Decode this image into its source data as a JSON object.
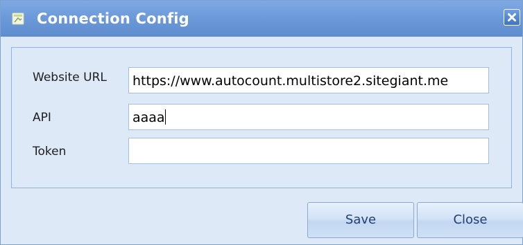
{
  "window": {
    "title": "Connection Config"
  },
  "form": {
    "website_url": {
      "label": "Website URL",
      "value": "https://www.autocount.multistore2.sitegiant.me"
    },
    "api": {
      "label": "API",
      "value": "aaaa"
    },
    "token": {
      "label": "Token",
      "value": ""
    }
  },
  "buttons": {
    "save_label": "Save",
    "close_label": "Close"
  },
  "colors": {
    "titlebar": "#6b98d8",
    "body_background": "#dde9f7",
    "group_border": "#8db2e3",
    "button_text": "#1e3f73"
  },
  "icons": {
    "title_icon": "form-icon",
    "close_icon": "close-icon"
  }
}
